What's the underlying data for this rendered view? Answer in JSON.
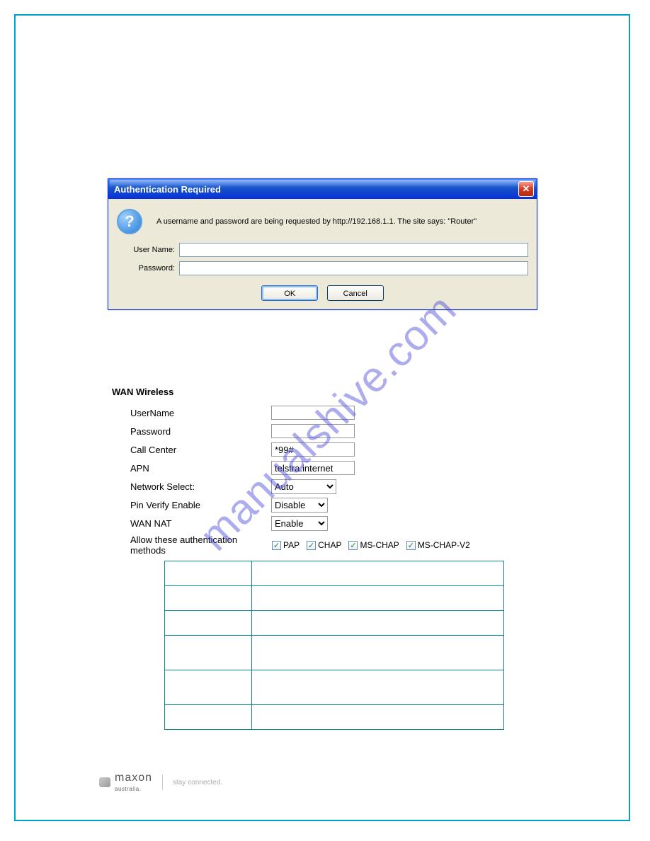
{
  "dialog": {
    "title": "Authentication Required",
    "close_glyph": "✕",
    "icon_glyph": "?",
    "message": "A username and password are being requested by http://192.168.1.1. The site says: \"Router\"",
    "username_label": "User Name:",
    "password_label": "Password:",
    "username_value": "",
    "password_value": "",
    "ok_label": "OK",
    "cancel_label": "Cancel"
  },
  "wan": {
    "title": "WAN Wireless",
    "rows": {
      "username": {
        "label": "UserName",
        "value": ""
      },
      "password": {
        "label": "Password",
        "value": ""
      },
      "call_center": {
        "label": "Call Center",
        "value": "*99#"
      },
      "apn": {
        "label": "APN",
        "value": "telstra.internet"
      },
      "network_select": {
        "label": "Network Select:",
        "value": "Auto"
      },
      "pin_verify": {
        "label": "Pin Verify Enable",
        "value": "Disable"
      },
      "wan_nat": {
        "label": "WAN NAT",
        "value": "Enable"
      }
    },
    "auth": {
      "label": "Allow these authentication methods",
      "methods": {
        "pap": "PAP",
        "chap": "CHAP",
        "mschap": "MS-CHAP",
        "mschapv2": "MS-CHAP-V2"
      },
      "check_glyph": "✓"
    }
  },
  "footer": {
    "brand": "maxon",
    "sub": "australia.",
    "tagline": "stay connected."
  },
  "watermark": "manualshive.com"
}
